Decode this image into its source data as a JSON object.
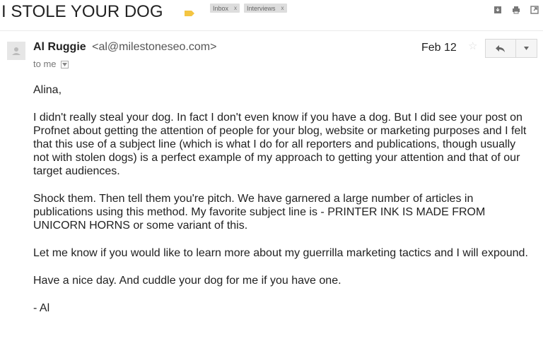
{
  "subject": {
    "title": "I STOLE YOUR DOG",
    "labels": [
      {
        "name": "Inbox",
        "remove": "x"
      },
      {
        "name": "Interviews",
        "remove": "x"
      }
    ]
  },
  "toolbar_icons": [
    "archive-icon",
    "print-icon",
    "new-window-icon"
  ],
  "message": {
    "sender_name": "Al Ruggie",
    "sender_email": "<al@milestoneseo.com>",
    "recipient": "to me",
    "date": "Feb 12",
    "star": "☆",
    "body": [
      "Alina,",
      "I didn't really steal your dog. In fact I don't even know if you have a dog. But I did see your post on Profnet about getting the attention of people for your blog, website or marketing purposes and I felt that this use of a subject line (which is what I do for all reporters and publications, though usually not with stolen dogs) is a perfect example of my approach to getting your attention and that of our target audiences.",
      "Shock them. Then tell them you're pitch. We have garnered a large number of articles in publications using this method. My favorite subject line is - PRINTER INK IS MADE FROM UNICORN HORNS or some variant of this.",
      "Let me know if you would like to learn more about my guerrilla marketing tactics and I will expound.",
      "Have a nice day. And cuddle your dog for me if you have one.",
      "- Al"
    ]
  },
  "colors": {
    "importance_marker": "#f4c542",
    "label_bg": "#dddddd",
    "text": "#222222",
    "muted": "#777777"
  }
}
